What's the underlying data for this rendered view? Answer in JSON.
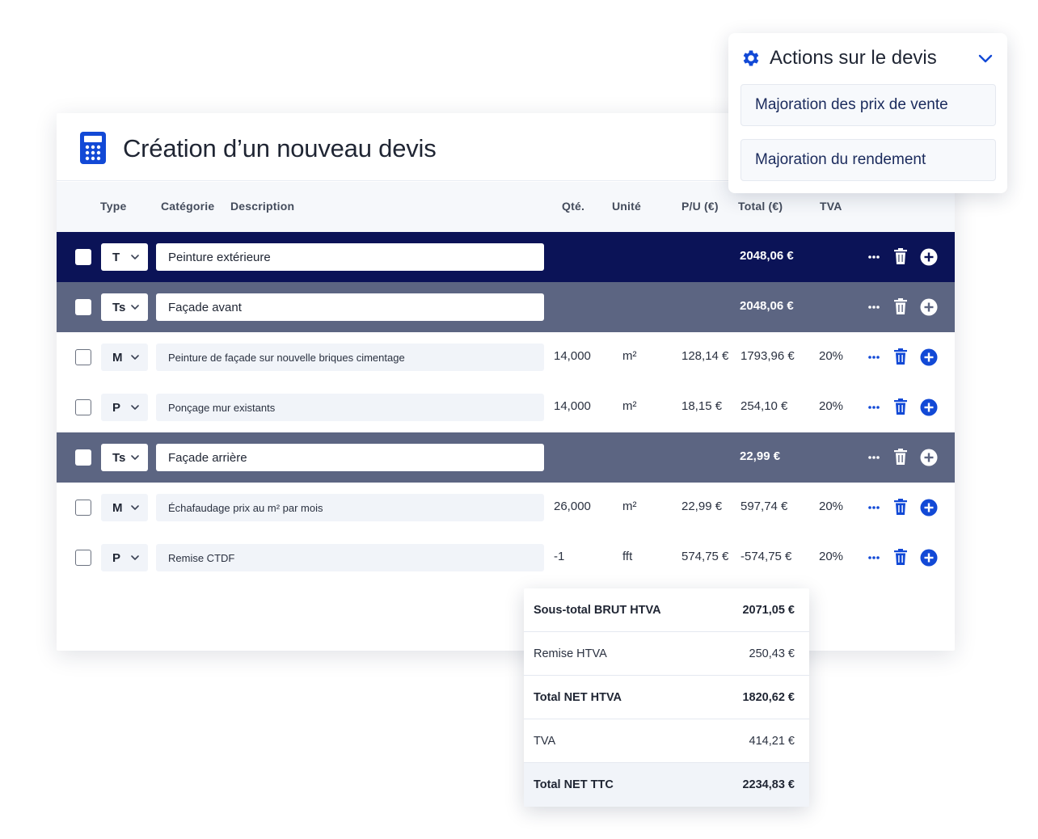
{
  "page_title": "Création d’un nouveau devis",
  "columns": {
    "type": "Type",
    "category": "Catégorie",
    "description": "Description",
    "qty": "Qté.",
    "unit": "Unité",
    "unit_price": "P/U (€)",
    "total": "Total (€)",
    "vat": "TVA"
  },
  "rows": [
    {
      "kind": "T",
      "type": "T",
      "description": "Peinture extérieure",
      "qty": "",
      "unit": "",
      "unit_price": "",
      "total": "2048,06 €",
      "vat": ""
    },
    {
      "kind": "Ts",
      "type": "Ts",
      "description": "Façade avant",
      "qty": "",
      "unit": "",
      "unit_price": "",
      "total": "2048,06 €",
      "vat": ""
    },
    {
      "kind": "item",
      "type": "M",
      "description": "Peinture de façade sur nouvelle briques cimentage",
      "qty": "14,000",
      "unit": "m²",
      "unit_price": "128,14 €",
      "total": "1793,96 €",
      "vat": "20%"
    },
    {
      "kind": "item",
      "type": "P",
      "description": "Ponçage mur existants",
      "qty": "14,000",
      "unit": "m²",
      "unit_price": "18,15 €",
      "total": "254,10 €",
      "vat": "20%"
    },
    {
      "kind": "Ts",
      "type": "Ts",
      "description": "Façade arrière",
      "qty": "",
      "unit": "",
      "unit_price": "",
      "total": "22,99 €",
      "vat": ""
    },
    {
      "kind": "item",
      "type": "M",
      "description": "Échafaudage prix au m² par mois",
      "qty": "26,000",
      "unit": "m²",
      "unit_price": "22,99 €",
      "total": "597,74 €",
      "vat": "20%"
    },
    {
      "kind": "item",
      "type": "P",
      "description": "Remise CTDF",
      "qty": "-1",
      "unit": "fft",
      "unit_price": "574,75 €",
      "total": "-574,75 €",
      "vat": "20%"
    }
  ],
  "actions": {
    "title": "Actions sur le devis",
    "items": [
      "Majoration des prix de vente",
      "Majoration du rendement"
    ]
  },
  "totals": [
    {
      "label": "Sous-total BRUT HTVA",
      "value": "2071,05 €",
      "bold": true
    },
    {
      "label": "Remise HTVA",
      "value": "250,43 €",
      "bold": false
    },
    {
      "label": "Total NET HTVA",
      "value": "1820,62 €",
      "bold": true
    },
    {
      "label": "TVA",
      "value": "414,21 €",
      "bold": false
    },
    {
      "label": "Total NET TTC",
      "value": "2234,83 €",
      "bold": true
    }
  ],
  "icons": {
    "title": "calculator-icon",
    "actions": "gear-icon",
    "row_actions": [
      "more-dots-icon",
      "trash-icon",
      "add-circle-icon"
    ],
    "select": "chevron-down-icon"
  },
  "colors": {
    "accent": "#1249d6",
    "title_row": "#0b1357",
    "subtitle_row": "#5c6582"
  }
}
